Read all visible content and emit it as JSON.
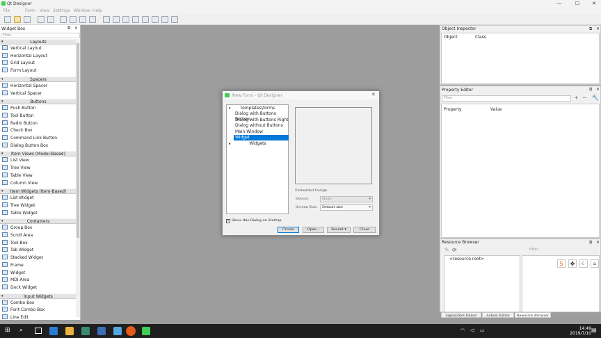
{
  "window": {
    "title": "Qt Designer",
    "minimize": "—",
    "maximize": "☐",
    "close": "✕"
  },
  "menu": [
    "File",
    "Form",
    "View",
    "Settings",
    "Window",
    "Help"
  ],
  "widget_box": {
    "title": "Widget Box",
    "filter_placeholder": "Filter",
    "categories": [
      {
        "label": "Layouts",
        "items": [
          "Vertical Layout",
          "Horizontal Layout",
          "Grid Layout",
          "Form Layout"
        ]
      },
      {
        "label": "Spacers",
        "items": [
          "Horizontal Spacer",
          "Vertical Spacer"
        ]
      },
      {
        "label": "Buttons",
        "items": [
          "Push Button",
          "Tool Button",
          "Radio Button",
          "Check Box",
          "Command Link Button",
          "Dialog Button Box"
        ]
      },
      {
        "label": "Item Views (Model-Based)",
        "items": [
          "List View",
          "Tree View",
          "Table View",
          "Column View"
        ]
      },
      {
        "label": "Item Widgets (Item-Based)",
        "items": [
          "List Widget",
          "Tree Widget",
          "Table Widget"
        ]
      },
      {
        "label": "Containers",
        "items": [
          "Group Box",
          "Scroll Area",
          "Tool Box",
          "Tab Widget",
          "Stacked Widget",
          "Frame",
          "Widget",
          "MDI Area",
          "Dock Widget"
        ]
      },
      {
        "label": "Input Widgets",
        "items": [
          "Combo Box",
          "Font Combo Box",
          "Line Edit"
        ]
      }
    ]
  },
  "object_inspector": {
    "title": "Object Inspector",
    "col_object": "Object",
    "col_class": "Class"
  },
  "property_editor": {
    "title": "Property Editor",
    "filter_placeholder": "Filter",
    "col_property": "Property",
    "col_value": "Value"
  },
  "resource_browser": {
    "title": "Resource Browser",
    "filter_placeholder": "Filter",
    "root": "<resource root>"
  },
  "bottom_tabs": [
    "Signal/Slot Editor",
    "Action Editor",
    "Resource Browser"
  ],
  "dialog": {
    "title": "New Form - Qt Designer",
    "close": "✕",
    "tree_header": "templates\\forms",
    "templates": [
      "Dialog with Buttons Bottom",
      "Dialog with Buttons Right",
      "Dialog without Buttons",
      "Main Window",
      "Widget"
    ],
    "selected": "Widget",
    "widgets_header": "Widgets",
    "embedded_design": "Embedded Design",
    "device_label": "Device:",
    "device_value": "None",
    "screen_size_label": "Screen Size:",
    "screen_size_value": "Default size",
    "show_on_startup": "Show this Dialog on Startup",
    "buttons": {
      "create": "Create",
      "open": "Open...",
      "recent": "Recent",
      "close": "Close"
    }
  },
  "taskbar": {
    "time": "14:49",
    "date": "2019/7/10"
  },
  "colors": {
    "accent": "#0078d7",
    "workspace": "#9d9d9d",
    "taskbar": "#1f1f1f"
  }
}
